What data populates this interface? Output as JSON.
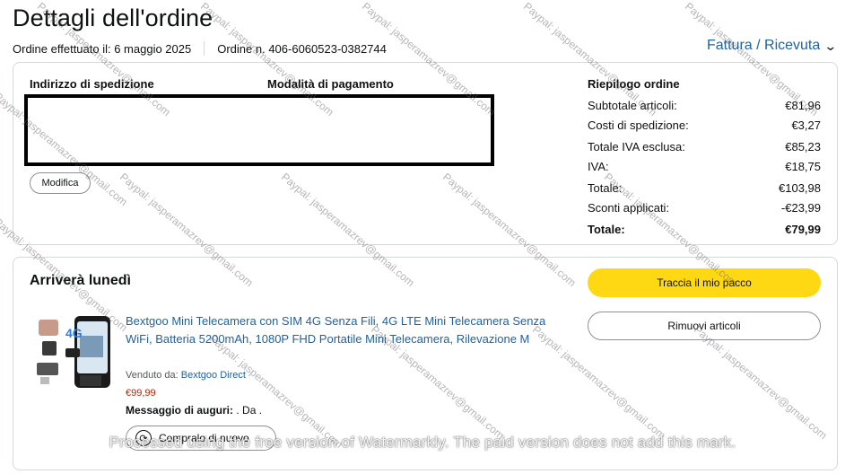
{
  "header": {
    "title": "Dettagli dell'ordine",
    "order_date": "Ordine effettuato il: 6 maggio 2025",
    "order_number": "Ordine n. 406-6060523-0382744",
    "invoice_link": "Fattura / Ricevuta"
  },
  "details": {
    "shipping_address_label": "Indirizzo di spedizione",
    "payment_method_label": "Modalità di pagamento",
    "edit_button": "Modifica"
  },
  "summary": {
    "title": "Riepilogo ordine",
    "rows": [
      {
        "label": "Subtotale articoli:",
        "value": "€81,96"
      },
      {
        "label": "Costi di spedizione:",
        "value": "€3,27"
      },
      {
        "label": "Totale IVA esclusa:",
        "value": "€85,23"
      },
      {
        "label": "IVA:",
        "value": "€18,75"
      },
      {
        "label": "Totale:",
        "value": "€103,98"
      },
      {
        "label": "Sconti applicati:",
        "value": "-€23,99"
      }
    ],
    "grand_total_label": "Totale:",
    "grand_total_value": "€79,99"
  },
  "shipment": {
    "arrival": "Arriverà lunedì",
    "track_button": "Traccia il mio pacco",
    "return_button": "Rimuovi articoli",
    "product": {
      "title": "Bextgoo Mini Telecamera con SIM 4G Senza Fili, 4G LTE Mini Telecamera Senza WiFi, Batteria 5200mAh, 1080P FHD Portatile Mini Telecamera, Rilevazione M",
      "sold_by_label": "Venduto da:",
      "seller": "Bextgoo Direct",
      "price": "€99,99",
      "gift_label": "Messaggio di auguri:",
      "gift_text": ". Da .",
      "buy_again": "Compralo di nuovo",
      "image_badge": "4G"
    }
  },
  "watermark": {
    "text": "Paypal: jasperamazrev@gmail.com",
    "footer": "Processed using the free version of Watermarkly. The paid version does not add this mark."
  },
  "colors": {
    "link": "#2162a1",
    "price": "#b12704",
    "track_button": "#ffd814",
    "border": "#d5d9d9"
  }
}
